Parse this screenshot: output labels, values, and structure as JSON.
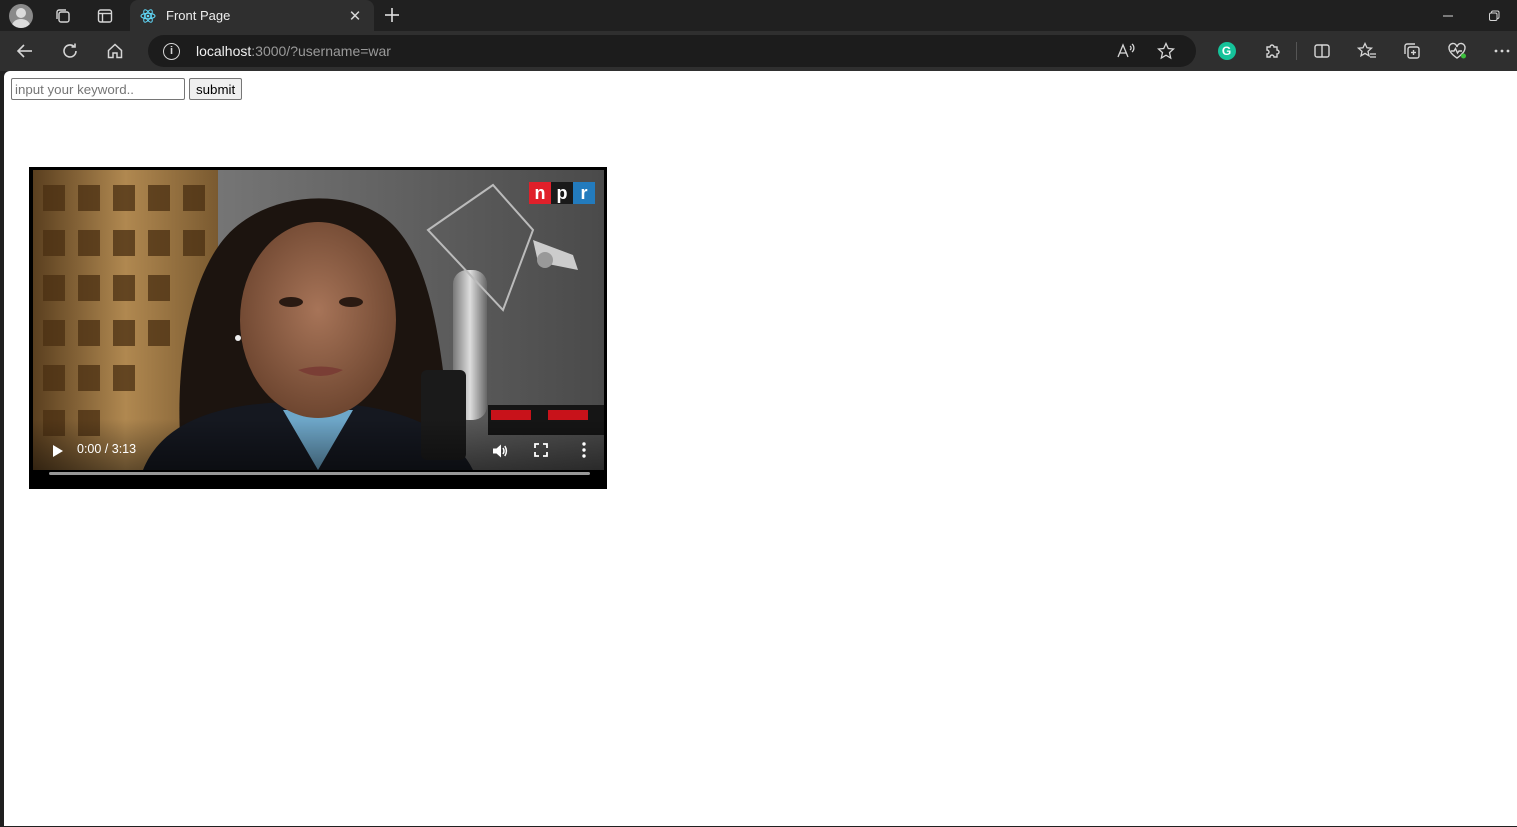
{
  "browser": {
    "tab": {
      "title": "Front Page"
    },
    "address": {
      "host": "localhost",
      "path": ":3000/?username=war"
    }
  },
  "page": {
    "search": {
      "placeholder": "input your keyword..",
      "value": ""
    },
    "submit_label": "submit"
  },
  "video": {
    "timecode": "0:00 / 3:13",
    "progress": 0.0,
    "watermark_text": "npr"
  },
  "colors": {
    "grammarly": "#15c39a",
    "react": "#61dafb",
    "npr_red": "#e0202a",
    "npr_blue": "#237bbd"
  }
}
